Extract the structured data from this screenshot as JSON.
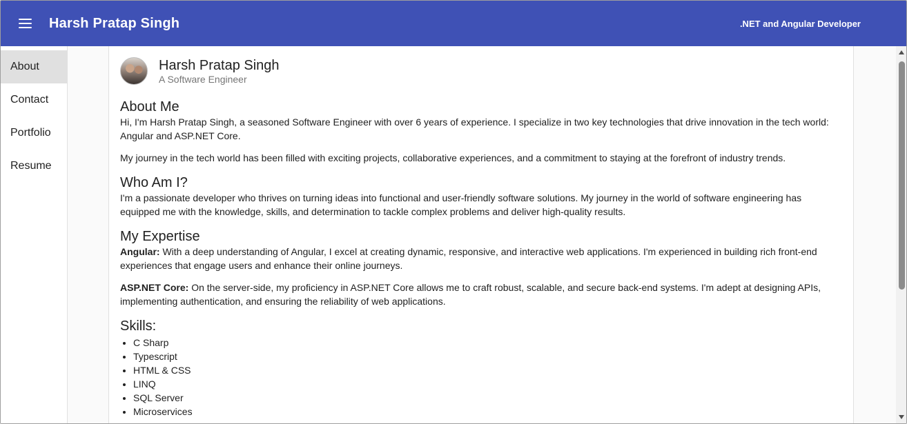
{
  "toolbar": {
    "title": "Harsh Pratap Singh",
    "right_text": ".NET and Angular Developer",
    "menu_icon": "hamburger-menu-icon",
    "background": "#3f51b5"
  },
  "sidebar": {
    "items": [
      {
        "label": "About",
        "active": true
      },
      {
        "label": "Contact"
      },
      {
        "label": "Portfolio"
      },
      {
        "label": "Resume"
      }
    ]
  },
  "profile": {
    "name": "Harsh Pratap Singh",
    "subtitle": "A Software Engineer"
  },
  "about": {
    "heading": "About Me",
    "p1": "Hi, I'm Harsh Pratap Singh, a seasoned Software Engineer with over 6 years of experience. I specialize in two key technologies that drive innovation in the tech world: Angular and ASP.NET Core.",
    "p2": "My journey in the tech world has been filled with exciting projects, collaborative experiences, and a commitment to staying at the forefront of industry trends."
  },
  "whoami": {
    "heading": "Who Am I?",
    "p1": "I'm a passionate developer who thrives on turning ideas into functional and user-friendly software solutions. My journey in the world of software engineering has equipped me with the knowledge, skills, and determination to tackle complex problems and deliver high-quality results."
  },
  "expertise": {
    "heading": "My Expertise",
    "angular_label": "Angular:",
    "angular_text": " With a deep understanding of Angular, I excel at creating dynamic, responsive, and interactive web applications. I'm experienced in building rich front-end experiences that engage users and enhance their online journeys.",
    "aspnet_label": "ASP.NET Core:",
    "aspnet_text": " On the server-side, my proficiency in ASP.NET Core allows me to craft robust, scalable, and secure back-end systems. I'm adept at designing APIs, implementing authentication, and ensuring the reliability of web applications."
  },
  "skills": {
    "heading": "Skills:",
    "items": [
      "C Sharp",
      "Typescript",
      "HTML & CSS",
      "LINQ",
      "SQL Server",
      "Microservices"
    ]
  }
}
